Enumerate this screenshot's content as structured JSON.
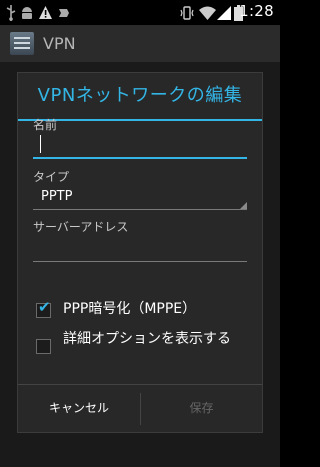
{
  "status_bar": {
    "time": "1:28",
    "icons": [
      "usb-icon",
      "android-debug-icon",
      "warning-icon",
      "download-icon",
      "vibrate-icon",
      "wifi-icon",
      "signal-icon",
      "battery-icon"
    ]
  },
  "action_bar": {
    "title": "VPN"
  },
  "dialog": {
    "title": "VPNネットワークの編集",
    "name_label": "名前",
    "name_value": "",
    "type_label": "タイプ",
    "type_value": "PPTP",
    "server_label": "サーバーアドレス",
    "server_value": "",
    "ppp_label": "PPP暗号化（MPPE）",
    "ppp_checked": true,
    "advanced_label": "詳細オプションを表示する",
    "advanced_checked": false
  },
  "buttons": {
    "cancel": "キャンセル",
    "save": "保存"
  },
  "colors": {
    "accent": "#33b5e5",
    "dialog_bg": "#282828"
  }
}
